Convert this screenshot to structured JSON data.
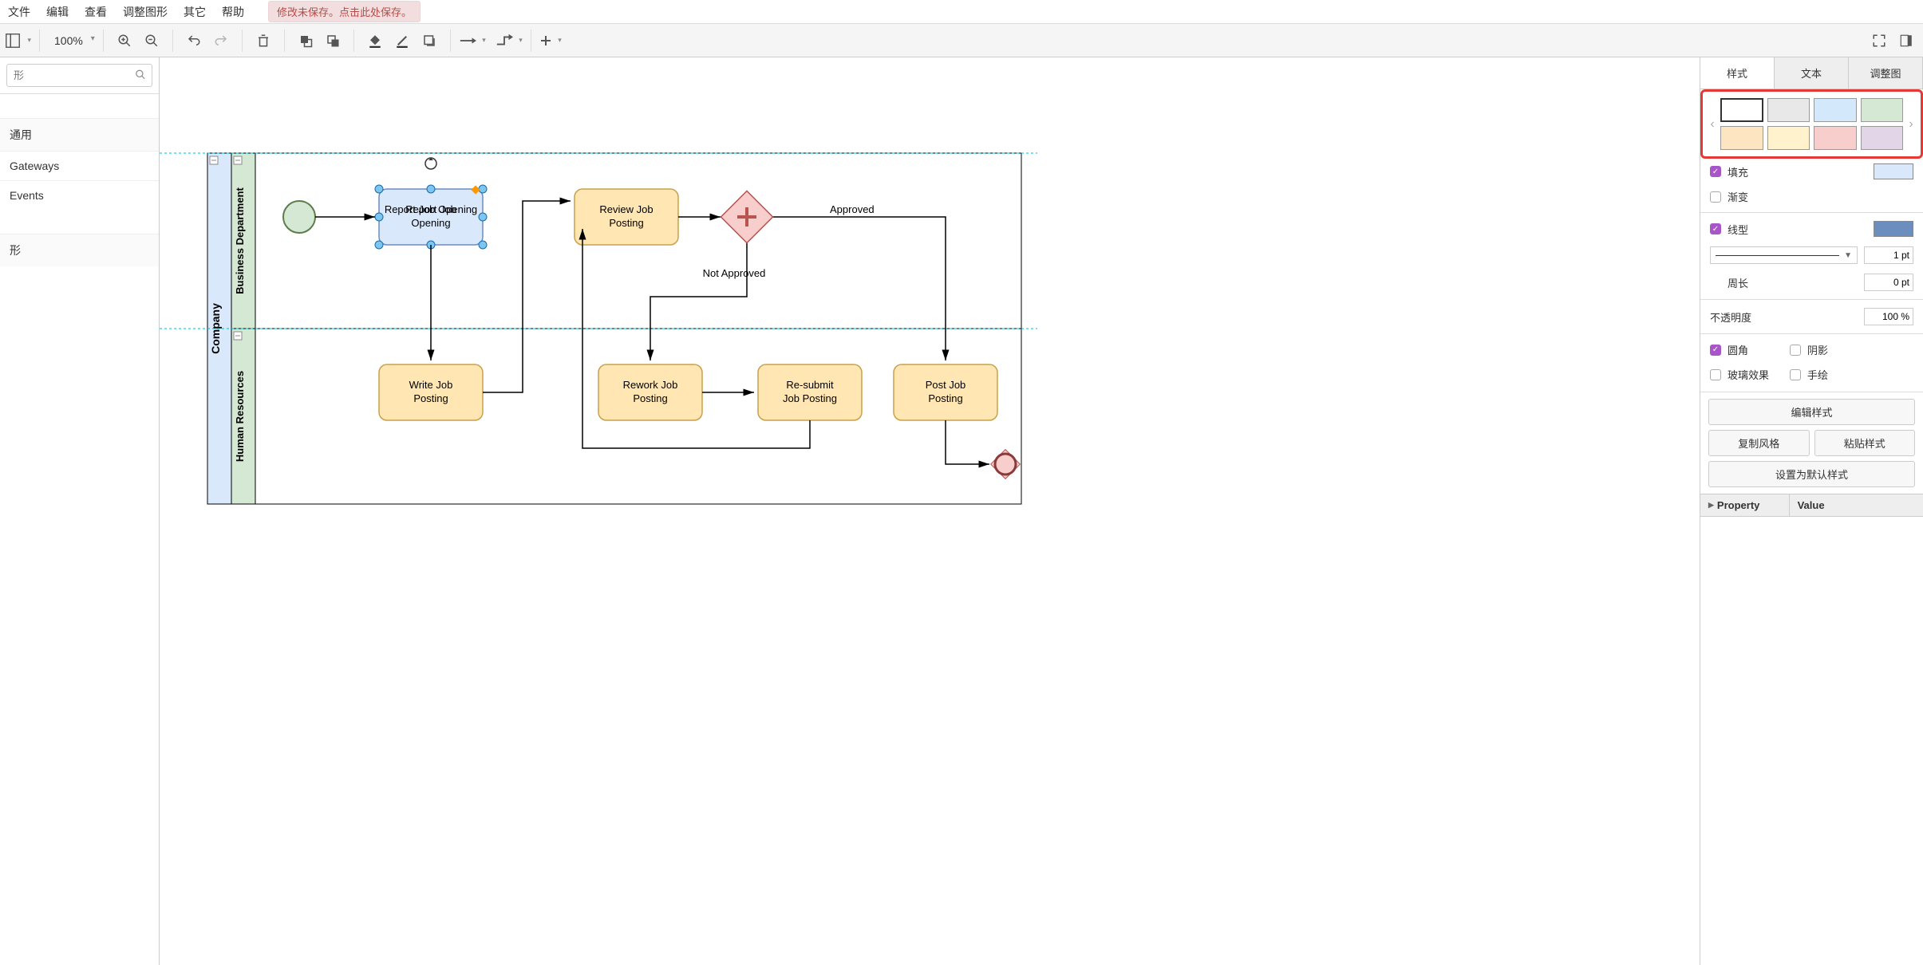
{
  "menu": {
    "items": [
      "文件",
      "编辑",
      "查看",
      "调整图形",
      "其它",
      "帮助"
    ],
    "unsaved_notice": "修改未保存。点击此处保存。"
  },
  "toolbar": {
    "zoom": "100%"
  },
  "sidebar_left": {
    "search_placeholder": "形",
    "sections": [
      {
        "title": "通用"
      },
      {
        "title": "Gateways"
      },
      {
        "title": "Events"
      },
      {
        "title": "形"
      }
    ]
  },
  "diagram": {
    "pool": "Company",
    "lanes": [
      "Business Department",
      "Human Resources"
    ],
    "tasks": {
      "report": "Report Job Opening",
      "review": "Review Job Posting",
      "write": "Write Job Posting",
      "rework": "Rework Job Posting",
      "resubmit": "Re-submit Job Posting",
      "post": "Post Job Posting"
    },
    "edge_labels": {
      "approved": "Approved",
      "not_approved": "Not Approved"
    }
  },
  "right_panel": {
    "tabs": [
      "样式",
      "文本",
      "调整图"
    ],
    "presets": [
      {
        "fill": "#ffffff",
        "selected": true
      },
      {
        "fill": "#e8e8e8"
      },
      {
        "fill": "#d4e8fc"
      },
      {
        "fill": "#d5e8d4"
      },
      {
        "fill": "#fde5c2"
      },
      {
        "fill": "#fff2cc"
      },
      {
        "fill": "#f8cecc"
      },
      {
        "fill": "#e1d5e7"
      }
    ],
    "props": {
      "fill_label": "填充",
      "fill_on": true,
      "fill_color": "#dae8fc",
      "gradient_label": "渐变",
      "gradient_on": false,
      "line_label": "线型",
      "line_on": true,
      "line_color": "#6c8ebf",
      "line_width": "1 pt",
      "perimeter_label": "周长",
      "perimeter_value": "0 pt",
      "opacity_label": "不透明度",
      "opacity_value": "100 %",
      "rounded_label": "圆角",
      "rounded_on": true,
      "shadow_label": "阴影",
      "shadow_on": false,
      "glass_label": "玻璃效果",
      "glass_on": false,
      "sketch_label": "手绘",
      "sketch_on": false
    },
    "buttons": {
      "edit_style": "编辑样式",
      "copy_style": "复制风格",
      "paste_style": "粘贴样式",
      "set_default": "设置为默认样式"
    },
    "prop_table": {
      "col_property": "Property",
      "col_value": "Value"
    }
  }
}
